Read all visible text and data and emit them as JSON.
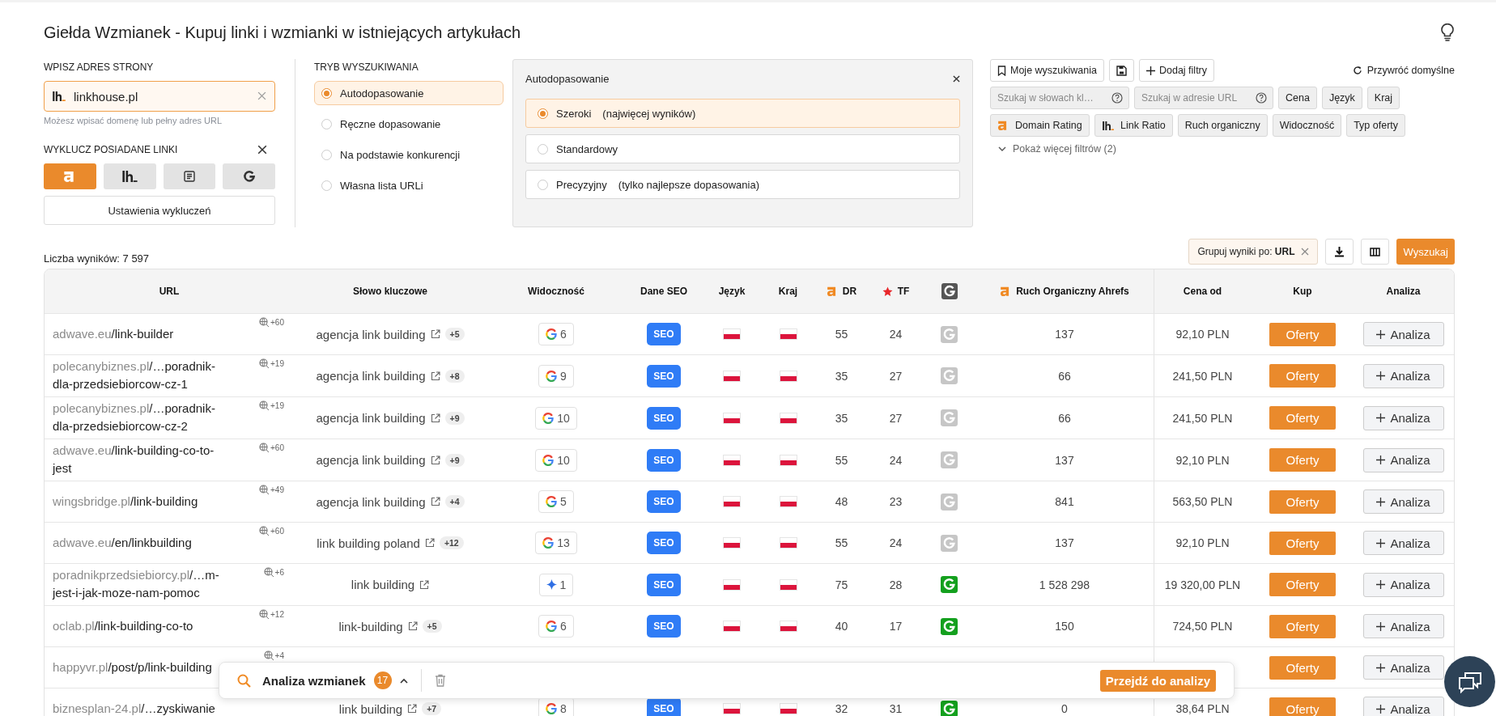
{
  "header": {
    "title": "Giełda Wzmianek - Kupuj linki i wzmianki w istniejących artykułach"
  },
  "site_input": {
    "label": "WPISZ ADRES STRONY",
    "value": "linkhouse.pl",
    "help": "Możesz wpisać domenę lub pełny adres URL"
  },
  "exclude": {
    "label": "WYKLUCZ POSIADANE LINKI",
    "sources": [
      {
        "kind": "ahrefs",
        "selected": true
      },
      {
        "kind": "linkhouse",
        "selected": false
      },
      {
        "kind": "list",
        "selected": false
      },
      {
        "kind": "google",
        "selected": false
      }
    ],
    "settings_button": "Ustawienia wykluczeń"
  },
  "search_mode": {
    "label": "TRYB WYSZUKIWANIA",
    "options": [
      {
        "label": "Autodopasowanie",
        "selected": true
      },
      {
        "label": "Ręczne dopasowanie",
        "selected": false
      },
      {
        "label": "Na podstawie konkurencji",
        "selected": false
      },
      {
        "label": "Własna lista URLi",
        "selected": false
      }
    ]
  },
  "match_panel": {
    "title": "Autodopasowanie",
    "options": [
      {
        "label": "Szeroki",
        "note": "(najwięcej wyników)",
        "selected": true
      },
      {
        "label": "Standardowy",
        "selected": false
      },
      {
        "label": "Precyzyjny",
        "note": "(tylko najlepsze dopasowania)",
        "selected": false
      }
    ]
  },
  "filters": {
    "buttons": [
      {
        "kind": "bookmark",
        "label": "Moje wyszukiwania"
      },
      {
        "kind": "save"
      },
      {
        "kind": "add",
        "label": "Dodaj filtry"
      }
    ],
    "reset": "Przywróć domyślne",
    "search_fields": [
      {
        "placeholder": "Szukaj w słowach kl…"
      },
      {
        "placeholder": "Szukaj w adresie URL"
      }
    ],
    "chips": [
      {
        "label": "Cena"
      },
      {
        "label": "Język"
      },
      {
        "label": "Kraj"
      },
      {
        "label": "Domain Rating",
        "kind": "ahrefs"
      },
      {
        "label": "Link Ratio",
        "kind": "linkhouse"
      },
      {
        "label": "Ruch organiczny"
      },
      {
        "label": "Widoczność"
      },
      {
        "label": "Typ oferty"
      }
    ],
    "more": "Pokaż więcej filtrów (2)"
  },
  "results": {
    "count": "Liczba wyników: 7 597",
    "group_by": "Grupuj wyniki po: **URL**",
    "search_button": "Wyszukaj"
  },
  "table": {
    "columns": [
      {
        "label": "URL"
      },
      {
        "label": "Słowo kluczowe"
      },
      {
        "label": "Widoczność"
      },
      {
        "label": "Dane SEO"
      },
      {
        "label": "Język"
      },
      {
        "label": "Kraj"
      },
      {
        "label": "DR",
        "kind": "ahrefs"
      },
      {
        "label": "TF",
        "kind": "star"
      },
      {
        "kind": "g"
      },
      {
        "label": "Ruch Organiczny Ahrefs",
        "kind": "ahrefs"
      },
      {
        "label": "Cena od"
      },
      {
        "label": "Kup"
      },
      {
        "label": "Analiza"
      }
    ],
    "rows": [
      {
        "domain": "adwave.eu",
        "path": "/link-builder",
        "mentions": "+60",
        "keyword": "agencja link building",
        "keyword_more": "+5",
        "visibility": {
          "kind": "google",
          "value": "6"
        },
        "seo": "SEO",
        "language": {
          "kind": "poland"
        },
        "country": {
          "kind": "poland"
        },
        "dr": "55",
        "tf": "24",
        "g_active": false,
        "traffic": "137",
        "price": "92,10 PLN",
        "buy": "Oferty",
        "analyze": "Analiza"
      },
      {
        "domain": "polecanybiznes.pl",
        "path": "/…poradnik-dla-przedsiebiorcow-cz-1",
        "mentions": "+19",
        "keyword": "agencja link building",
        "keyword_more": "+8",
        "visibility": {
          "kind": "google",
          "value": "9"
        },
        "seo": "SEO",
        "language": {
          "kind": "poland"
        },
        "country": {
          "kind": "poland"
        },
        "dr": "35",
        "tf": "27",
        "g_active": false,
        "traffic": "66",
        "price": "241,50 PLN",
        "buy": "Oferty",
        "analyze": "Analiza"
      },
      {
        "domain": "polecanybiznes.pl",
        "path": "/…poradnik-dla-przedsiebiorcow-cz-2",
        "mentions": "+19",
        "keyword": "agencja link building",
        "keyword_more": "+9",
        "visibility": {
          "kind": "google",
          "value": "10"
        },
        "seo": "SEO",
        "language": {
          "kind": "poland"
        },
        "country": {
          "kind": "poland"
        },
        "dr": "35",
        "tf": "27",
        "g_active": false,
        "traffic": "66",
        "price": "241,50 PLN",
        "buy": "Oferty",
        "analyze": "Analiza"
      },
      {
        "domain": "adwave.eu",
        "path": "/link-building-co-to-jest",
        "mentions": "+60",
        "keyword": "agencja link building",
        "keyword_more": "+9",
        "visibility": {
          "kind": "google",
          "value": "10"
        },
        "seo": "SEO",
        "language": {
          "kind": "poland"
        },
        "country": {
          "kind": "poland"
        },
        "dr": "55",
        "tf": "24",
        "g_active": false,
        "traffic": "137",
        "price": "92,10 PLN",
        "buy": "Oferty",
        "analyze": "Analiza"
      },
      {
        "domain": "wingsbridge.pl",
        "path": "/link-building",
        "mentions": "+49",
        "keyword": "agencja link building",
        "keyword_more": "+4",
        "visibility": {
          "kind": "google",
          "value": "5"
        },
        "seo": "SEO",
        "language": {
          "kind": "poland"
        },
        "country": {
          "kind": "poland"
        },
        "dr": "48",
        "tf": "23",
        "g_active": false,
        "traffic": "841",
        "price": "563,50 PLN",
        "buy": "Oferty",
        "analyze": "Analiza"
      },
      {
        "domain": "adwave.eu",
        "path": "/en/linkbuilding",
        "mentions": "+60",
        "keyword": "link building poland",
        "keyword_more": "+12",
        "visibility": {
          "kind": "google",
          "value": "13"
        },
        "seo": "SEO",
        "language": {
          "kind": "poland"
        },
        "country": {
          "kind": "poland"
        },
        "dr": "55",
        "tf": "24",
        "g_active": false,
        "traffic": "137",
        "price": "92,10 PLN",
        "buy": "Oferty",
        "analyze": "Analiza"
      },
      {
        "domain": "poradnikprzedsiebiorcy.pl",
        "path": "/…m-jest-i-jak-moze-nam-pomoc",
        "mentions": "+6",
        "keyword": "link building",
        "visibility": {
          "kind": "sparkle",
          "value": "1"
        },
        "seo": "SEO",
        "language": {
          "kind": "poland"
        },
        "country": {
          "kind": "poland"
        },
        "dr": "75",
        "tf": "28",
        "g_active": true,
        "traffic": "1 528 298",
        "price": "19 320,00 PLN",
        "buy": "Oferty",
        "analyze": "Analiza"
      },
      {
        "domain": "oclab.pl",
        "path": "/link-building-co-to",
        "mentions": "+12",
        "keyword": "link-building",
        "keyword_more": "+5",
        "visibility": {
          "kind": "google",
          "value": "6"
        },
        "seo": "SEO",
        "language": {
          "kind": "poland"
        },
        "country": {
          "kind": "poland"
        },
        "dr": "40",
        "tf": "17",
        "g_active": true,
        "traffic": "150",
        "price": "724,50 PLN",
        "buy": "Oferty",
        "analyze": "Analiza"
      },
      {
        "domain": "happyvr.pl",
        "path": "/post/p/link-building",
        "mentions": "+4",
        "buy": "Oferty",
        "analyze": "Analiza"
      },
      {
        "domain": "biznesplan-24.pl",
        "path": "/…zyskiwanie",
        "keyword": "link building",
        "keyword_more": "+7",
        "visibility": {
          "kind": "google",
          "value": "8"
        },
        "seo": "SEO",
        "language": {
          "kind": "poland"
        },
        "country": {
          "kind": "poland"
        },
        "dr": "32",
        "tf": "31",
        "g_active": true,
        "traffic": "0",
        "price": "38,64 PLN",
        "buy": "Oferty",
        "analyze": "Analiza"
      }
    ]
  },
  "analysis_bar": {
    "title": "Analiza wzmianek",
    "count": "17",
    "action": "Przejdź do analizy"
  }
}
